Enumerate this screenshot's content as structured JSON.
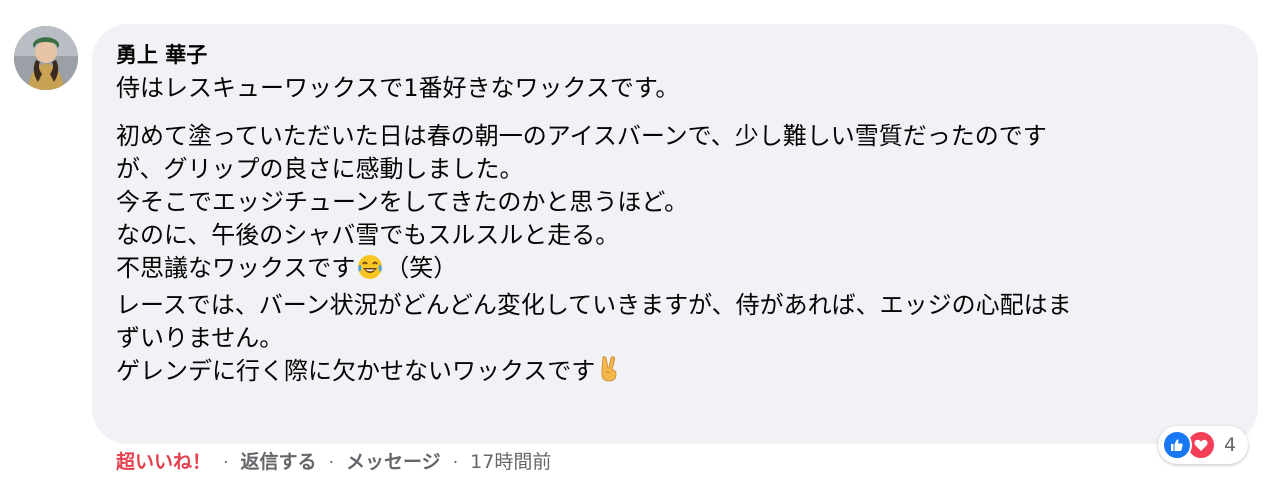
{
  "comment": {
    "author": "勇上 華子",
    "paragraphs": [
      [
        "侍はレスキューワックスで1番好きなワックスです。"
      ],
      [
        "初めて塗っていただいた日は春の朝一のアイスバーンで、少し難しい雪質だったのです",
        "が、グリップの良さに感動しました。",
        "今そこでエッジチューンをしてきたのかと思うほど。",
        "なのに、午後のシャバ雪でもスルスルと走る。"
      ]
    ],
    "line_laugh_before": "不思議なワックスです",
    "line_laugh_after": "（笑）",
    "line_race_1": "レースでは、バーン状況がどんどん変化していきますが、侍があれば、エッジの心配はま",
    "line_race_2": "ずいりません。",
    "line_last": "ゲレンデに行く際に欠かせないワックスです",
    "emoji_laugh": "laughing-tears-emoji",
    "emoji_victory": "victory-hand-emoji"
  },
  "actions": {
    "like_label": "超いいね！",
    "reply_label": "返信する",
    "message_label": "メッセージ",
    "separator": "·",
    "time": "17時間前"
  },
  "reactions": {
    "icons": [
      "like-icon",
      "love-icon"
    ],
    "count": "4"
  },
  "colors": {
    "bubble_bg": "#f0f2f5",
    "liked_red": "#e4404d",
    "like_blue": "#1877f2",
    "love_red": "#f33e58",
    "meta_gray": "#65676b"
  }
}
